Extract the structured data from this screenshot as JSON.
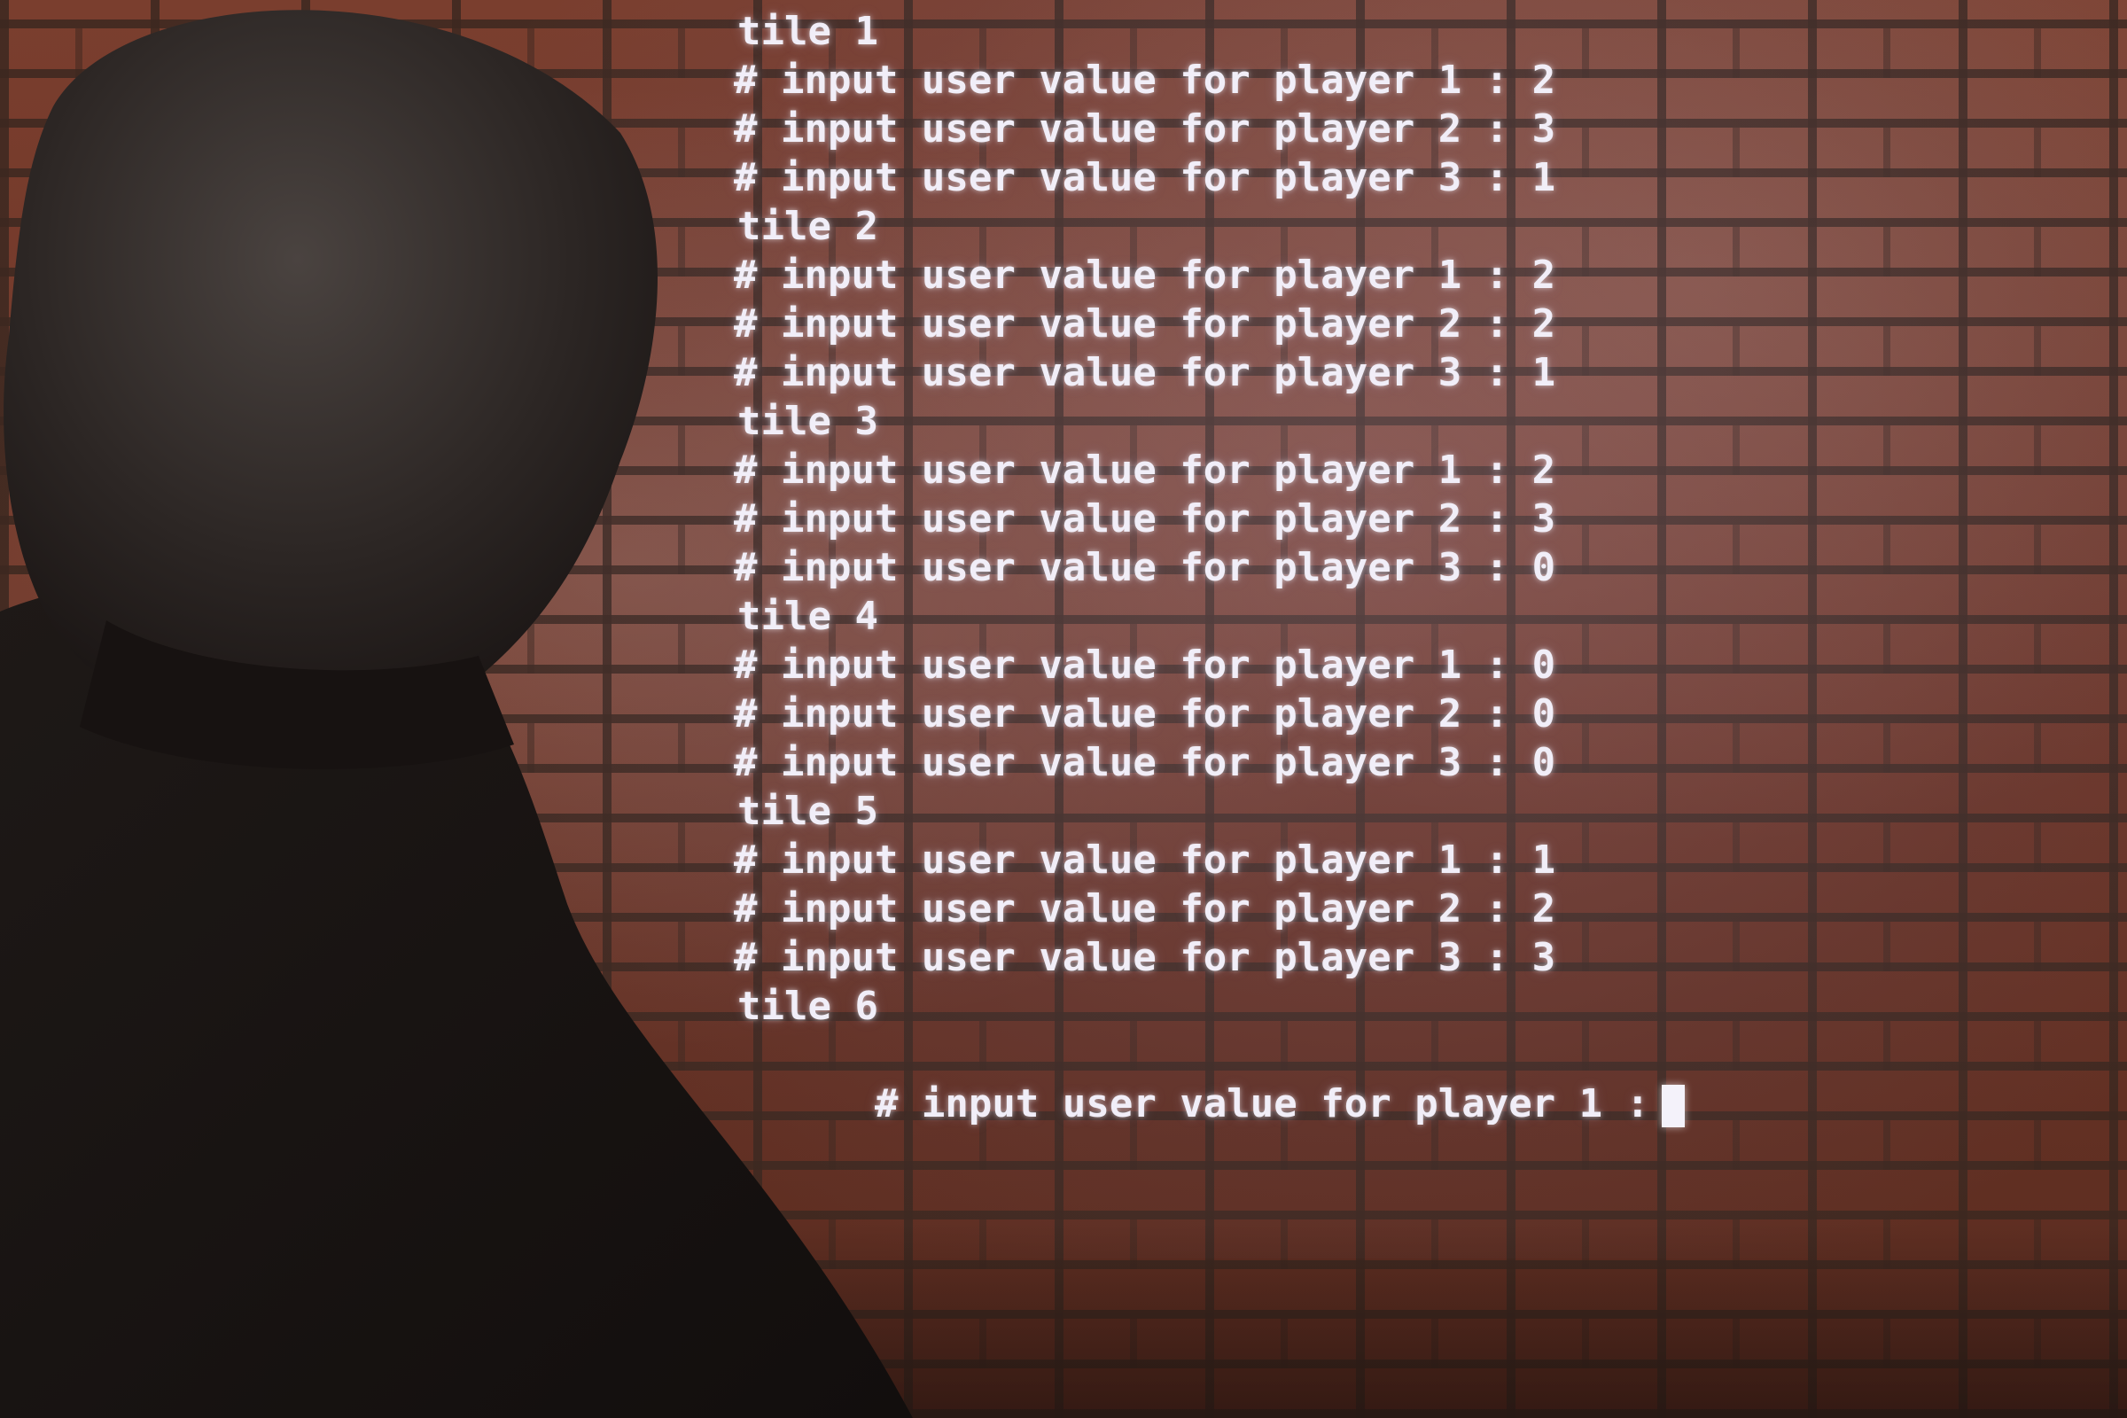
{
  "terminal": {
    "lines": [
      {
        "kind": "tile",
        "text": "tile 1"
      },
      {
        "kind": "input",
        "text": "# input user value for player 1 : 2"
      },
      {
        "kind": "input",
        "text": "# input user value for player 2 : 3"
      },
      {
        "kind": "input",
        "text": "# input user value for player 3 : 1"
      },
      {
        "kind": "tile",
        "text": "tile 2"
      },
      {
        "kind": "input",
        "text": "# input user value for player 1 : 2"
      },
      {
        "kind": "input",
        "text": "# input user value for player 2 : 2"
      },
      {
        "kind": "input",
        "text": "# input user value for player 3 : 1"
      },
      {
        "kind": "tile",
        "text": "tile 3"
      },
      {
        "kind": "input",
        "text": "# input user value for player 1 : 2"
      },
      {
        "kind": "input",
        "text": "# input user value for player 2 : 3"
      },
      {
        "kind": "input",
        "text": "# input user value for player 3 : 0"
      },
      {
        "kind": "tile",
        "text": "tile 4"
      },
      {
        "kind": "input",
        "text": "# input user value for player 1 : 0"
      },
      {
        "kind": "input",
        "text": "# input user value for player 2 : 0"
      },
      {
        "kind": "input",
        "text": "# input user value for player 3 : 0"
      },
      {
        "kind": "tile",
        "text": "tile 5"
      },
      {
        "kind": "input",
        "text": "# input user value for player 1 : 1"
      },
      {
        "kind": "input",
        "text": "# input user value for player 2 : 2"
      },
      {
        "kind": "input",
        "text": "# input user value for player 3 : 3"
      },
      {
        "kind": "tile",
        "text": "tile 6"
      }
    ],
    "prompt": "# input user value for player 1 :"
  },
  "colors": {
    "terminal_text": "#f1eef8",
    "brick": "#6b3a2c",
    "mortar": "#3c2820",
    "silhouette": "#1a1412"
  }
}
